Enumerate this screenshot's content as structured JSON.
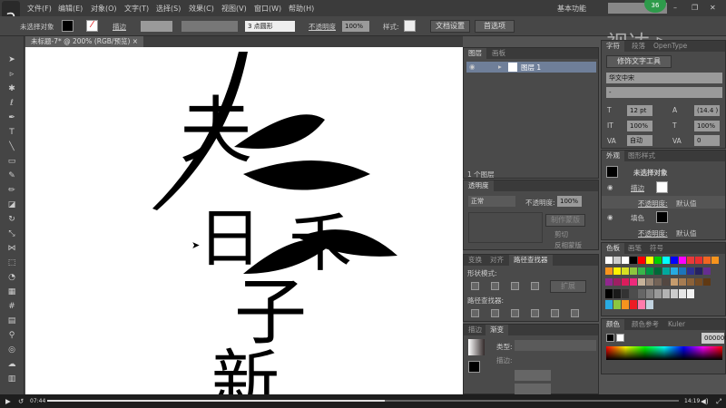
{
  "app": {
    "logo": "Ai",
    "overlay_letter": "a",
    "badge": "36",
    "watermark": "视达"
  },
  "menu": [
    "文件(F)",
    "编辑(E)",
    "对象(O)",
    "文字(T)",
    "选择(S)",
    "效果(C)",
    "视图(V)",
    "窗口(W)",
    "帮助(H)"
  ],
  "workspace": "基本功能",
  "control": {
    "selection": "未选择对象",
    "stroke_label": "描边",
    "brush": "3 点圆形",
    "opacity_label": "不透明度",
    "opacity": "100%",
    "style_label": "样式:",
    "doc_setup": "文档设置",
    "prefs": "首选项"
  },
  "document_tab": "未标题-7* @ 200% (RGB/预览)",
  "artwork": {
    "chars": [
      "夫",
      "日",
      "禾",
      "子",
      "新"
    ]
  },
  "layers": {
    "tabs": [
      "图层",
      "画板"
    ],
    "layer_name": "图层 1",
    "count": "1 个图层"
  },
  "transparency": {
    "title": "透明度",
    "mode": "正常",
    "opacity_label": "不透明度:",
    "opacity": "100%",
    "make_mask": "制作蒙版",
    "clip": "剪切",
    "invert": "反相蒙版"
  },
  "pathfinder": {
    "tabs": [
      "变换",
      "对齐",
      "路径查找器"
    ],
    "shape_modes": "形状模式:",
    "expand": "扩展",
    "pathfinders": "路径查找器:"
  },
  "gradient": {
    "tabs": [
      "描边",
      "渐变"
    ],
    "type_label": "类型:",
    "stroke_label": "描边:"
  },
  "character": {
    "tabs": [
      "字符",
      "段落",
      "OpenType"
    ],
    "touch_tool": "修饰文字工具",
    "font": "华文中宋",
    "style": "-",
    "size": "12 pt",
    "leading": "(14.4 )",
    "hscale": "100%",
    "vscale": "100%",
    "kerning": "自动",
    "tracking": "0"
  },
  "appearance": {
    "tabs": [
      "外观",
      "图形样式"
    ],
    "title": "未选择对象",
    "stroke": "描边",
    "opacity_label": "不透明度:",
    "opacity_value": "默认值",
    "fill": "填色"
  },
  "swatches": {
    "tabs": [
      "色板",
      "画笔",
      "符号"
    ],
    "row1": [
      "#ffffff",
      "#cccccc",
      "#ffffff",
      "#000000",
      "#ff0000",
      "#ffff00",
      "#00cc00",
      "#00ffff",
      "#0000ff",
      "#ff00ff",
      "#e83a3a",
      "#e83030",
      "#f26522",
      "#f7941d"
    ],
    "row2": [
      "#f7941d",
      "#fff200",
      "#d7df23",
      "#8dc63f",
      "#39b54a",
      "#009444",
      "#006838",
      "#00a99d",
      "#27aae1",
      "#1c75bc",
      "#2e3192",
      "#262262",
      "#662d91"
    ],
    "row3": [
      "#92278f",
      "#9e1f63",
      "#da1c5c",
      "#ee2a7b",
      "#c7b299",
      "#998675",
      "#736357",
      "#534741",
      "#c69c6d",
      "#a67c52",
      "#8c6239",
      "#754c24",
      "#603913"
    ],
    "row4": [
      "#000000",
      "#1a1a1a",
      "#333333",
      "#4d4d4d",
      "#666666",
      "#808080",
      "#999999",
      "#b3b3b3",
      "#cccccc",
      "#e6e6e6",
      "#f2f2f2"
    ],
    "row5": [
      "#29abe2",
      "#8cc63f",
      "#f7931e",
      "#ed1c24",
      "#ff7bac",
      "#c1d3e0"
    ]
  },
  "color": {
    "tabs": [
      "颜色",
      "颜色参考",
      "Kuler"
    ],
    "hex": "000000"
  },
  "player": {
    "current": "07:44",
    "total": "14:19",
    "progress": 0.535
  }
}
